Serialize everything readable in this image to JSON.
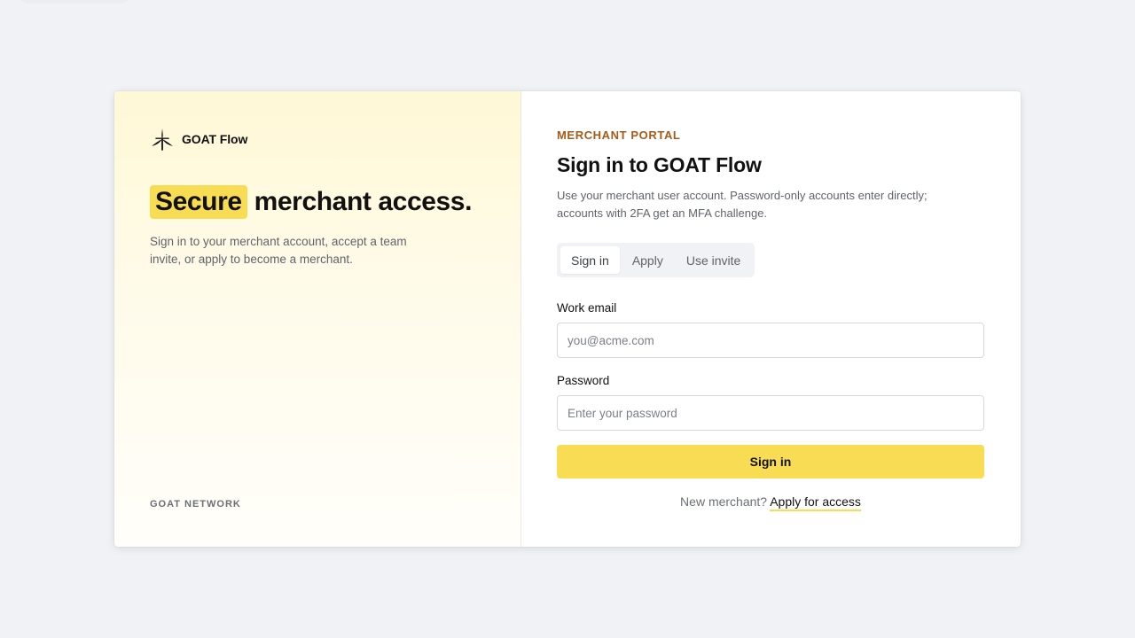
{
  "brand": {
    "name": "GOAT Flow"
  },
  "hero": {
    "highlight": "Secure",
    "rest": "merchant access.",
    "subtitle": "Sign in to your merchant account, accept a team invite, or apply to become a merchant."
  },
  "network_label": "GOAT NETWORK",
  "form": {
    "eyebrow": "MERCHANT PORTAL",
    "title": "Sign in to GOAT Flow",
    "description": "Use your merchant user account. Password-only accounts enter directly; accounts with 2FA get an MFA challenge.",
    "tabs": [
      {
        "label": "Sign in",
        "active": true
      },
      {
        "label": "Apply",
        "active": false
      },
      {
        "label": "Use invite",
        "active": false
      }
    ],
    "email": {
      "label": "Work email",
      "value": "",
      "placeholder": "you@acme.com"
    },
    "password": {
      "label": "Password",
      "value": "",
      "placeholder": "Enter your password"
    },
    "submit_label": "Sign in",
    "footer_prefix": "New merchant?",
    "footer_link": "Apply for access"
  },
  "colors": {
    "accent": "#f8dc53",
    "eyebrow": "#a85a17",
    "background": "#f0f2f5"
  },
  "icons": {
    "brand": "sparkle-star-icon"
  }
}
